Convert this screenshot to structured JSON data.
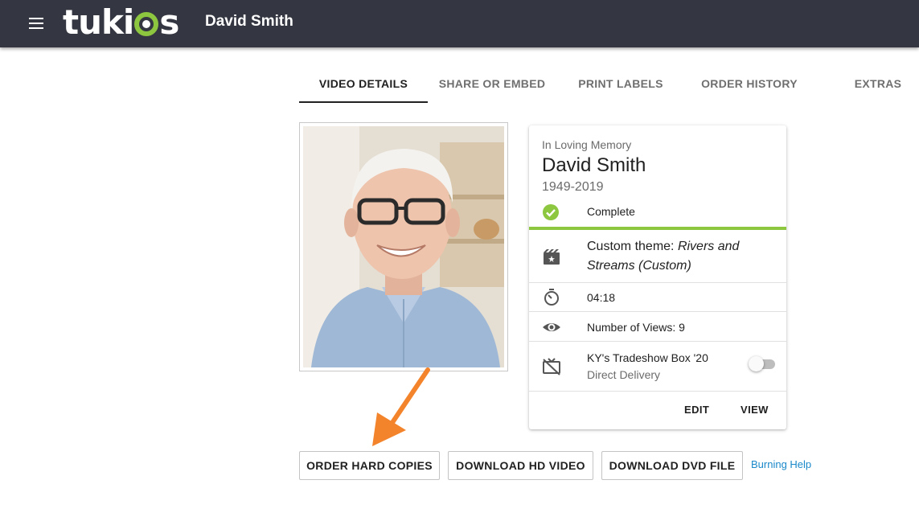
{
  "header": {
    "menu_icon": "hamburger-menu-icon",
    "logo_text": "tukios",
    "title": "David Smith",
    "background_color": "#343741"
  },
  "tabs": [
    {
      "label": "VIDEO DETAILS",
      "active": true
    },
    {
      "label": "SHARE OR EMBED",
      "active": false
    },
    {
      "label": "PRINT LABELS",
      "active": false
    },
    {
      "label": "ORDER HISTORY",
      "active": false
    },
    {
      "label": "EXTRAS",
      "active": false
    }
  ],
  "photo": {
    "description_icon": "portrait-photo"
  },
  "card": {
    "subtitle": "In Loving Memory",
    "name": "David Smith",
    "years": "1949-2019",
    "status": {
      "label": "Complete",
      "icon": "check-circle-icon",
      "color": "#8dc63f"
    },
    "theme": {
      "prefix": "Custom theme: ",
      "name": "Rivers and Streams (Custom)",
      "icon": "movie-filter-icon"
    },
    "duration": {
      "value": "04:18",
      "icon": "timer-icon"
    },
    "views": {
      "label": "Number of Views: 9",
      "icon": "eye-icon"
    },
    "delivery": {
      "title": "KY's Tradeshow Box '20",
      "subtitle": "Direct Delivery",
      "icon": "tv-off-icon",
      "toggle_on": false
    },
    "actions": {
      "edit": "EDIT",
      "view": "VIEW"
    }
  },
  "buttons": {
    "order": "ORDER HARD COPIES",
    "download_hd": "DOWNLOAD HD VIDEO",
    "download_dvd": "DOWNLOAD DVD FILE",
    "help_link": "Burning Help"
  },
  "colors": {
    "accent_green": "#8dc63f",
    "link_blue": "#1a88c9",
    "arrow_orange": "#f4842b"
  }
}
